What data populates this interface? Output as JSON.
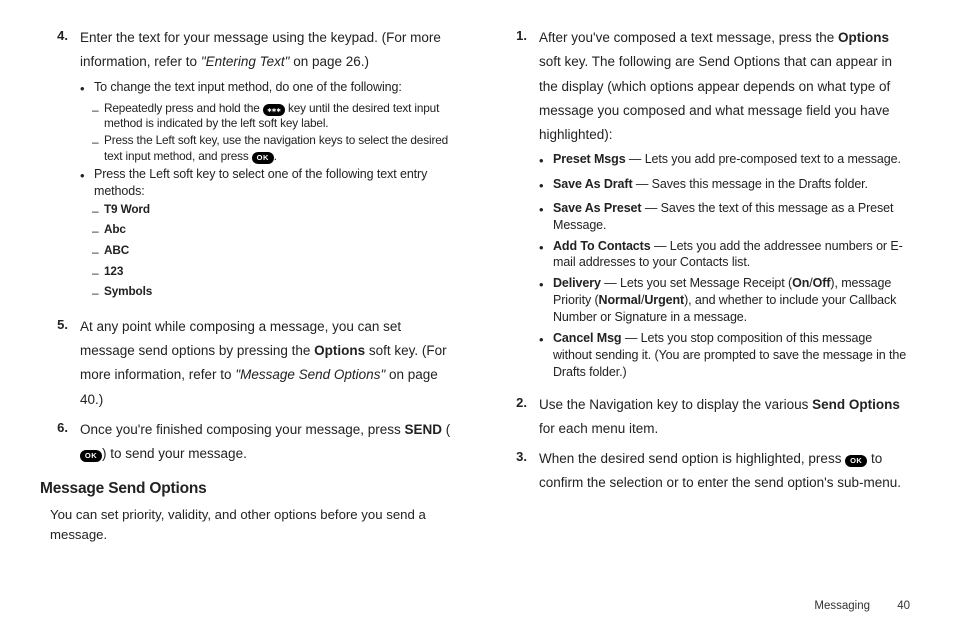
{
  "left": {
    "step4": {
      "num": "4.",
      "text_a": "Enter the text for your message using the keypad. (For more information, refer to ",
      "text_ref": "\"Entering Text\"",
      "text_b": "  on page 26.)",
      "bullet1": "To change the text input method, do one of the following:",
      "dash1a": "Repeatedly press and hold the ",
      "dash1b": " key until the desired text input method is indicated by the left soft key label.",
      "dash2a": "Press the Left soft key, use the navigation keys to select the desired text input method, and press ",
      "dash2b": ".",
      "bullet2": "Press the Left soft key to select one of the following text entry methods:",
      "m1": "T9 Word",
      "m2": "Abc",
      "m3": "ABC",
      "m4": "123",
      "m5": "Symbols"
    },
    "step5": {
      "num": "5.",
      "text_a": "At any point while composing a message, you can set message send options by pressing the ",
      "text_opt": "Options",
      "text_b": " soft key. (For more information, refer to ",
      "text_ref": "\"Message Send Options\"",
      "text_c": "  on page 40.)"
    },
    "step6": {
      "num": "6.",
      "text_a": "Once you're finished composing your message, press ",
      "text_send": "SEND",
      "text_b": " (",
      "text_c": ") to send your message."
    },
    "heading": "Message Send Options",
    "intro": "You can set priority, validity, and other options before you send a message."
  },
  "right": {
    "step1": {
      "num": "1.",
      "text_a": "After you've composed a text message, press the ",
      "text_opt": "Options",
      "text_b": " soft key. The following are Send Options that can appear in the display (which options appear depends on what type of message you composed and what message field you have highlighted):",
      "b1": {
        "t": "Preset Msgs",
        "d": " — Lets you add pre-composed text to a message."
      },
      "b2": {
        "t": "Save As Draft",
        "d": " — Saves this message in the Drafts folder."
      },
      "b3": {
        "t": "Save As Preset",
        "d": " — Saves the text of this message as a Preset Message."
      },
      "b4": {
        "t": "Add To Contacts",
        "d": " — Lets you add the addressee numbers or E-mail addresses to your Contacts list."
      },
      "b5a": "Delivery",
      "b5b": " — Lets you set Message Receipt (",
      "b5c": "On",
      "b5d": "/",
      "b5e": "Off",
      "b5f": "), message Priority (",
      "b5g": "Normal",
      "b5h": "/",
      "b5i": "Urgent",
      "b5j": "), and whether to include your Callback Number or Signature in a message.",
      "b6": {
        "t": "Cancel Msg",
        "d": " — Lets you stop composition of this message without sending it. (You are prompted to save the message in the Drafts folder.)"
      }
    },
    "step2": {
      "num": "2.",
      "text_a": "Use the Navigation key to display the various ",
      "text_so": "Send Options",
      "text_b": " for each menu item."
    },
    "step3": {
      "num": "3.",
      "text_a": "When the desired send option is highlighted, press ",
      "text_b": " to confirm the selection or to enter the send option's sub-menu."
    }
  },
  "footer": {
    "section": "Messaging",
    "page": "40"
  }
}
